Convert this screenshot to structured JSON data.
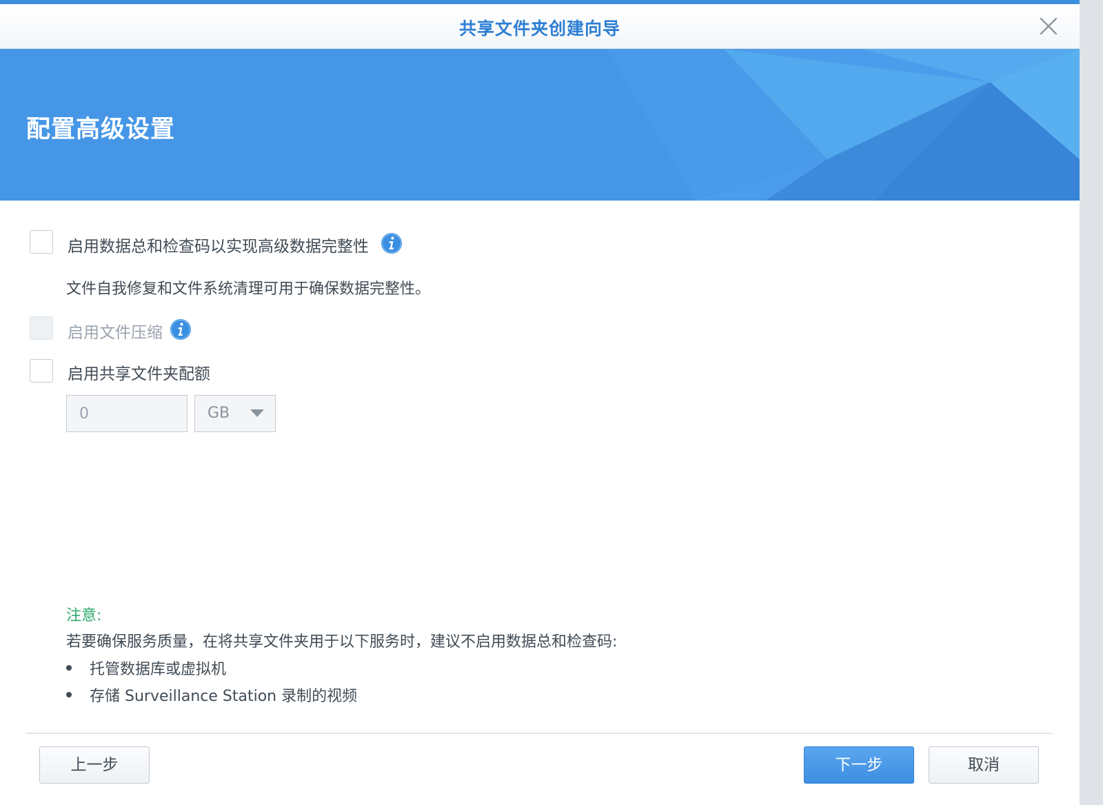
{
  "window": {
    "title": "共享文件夹创建向导",
    "accent_color": "#3d8fe0"
  },
  "banner": {
    "heading": "配置高级设置",
    "color": "#4596e6"
  },
  "options": {
    "checksum": {
      "label": "启用数据总和检查码以实现高级数据完整性",
      "description": "文件自我修复和文件系统清理可用于确保数据完整性。",
      "checked": false,
      "disabled": false
    },
    "compression": {
      "label": "启用文件压缩",
      "checked": false,
      "disabled": true
    },
    "quota": {
      "label": "启用共享文件夹配额",
      "checked": false,
      "value": "0",
      "unit": "GB"
    }
  },
  "note": {
    "title": "注意:",
    "text": "若要确保服务质量，在将共享文件夹用于以下服务时，建议不启用数据总和检查码:",
    "items": [
      "托管数据库或虚拟机",
      "存储 Surveillance Station 录制的视频"
    ],
    "title_color": "#2ea86b"
  },
  "footer": {
    "back_label": "上一步",
    "next_label": "下一步",
    "cancel_label": "取消"
  }
}
